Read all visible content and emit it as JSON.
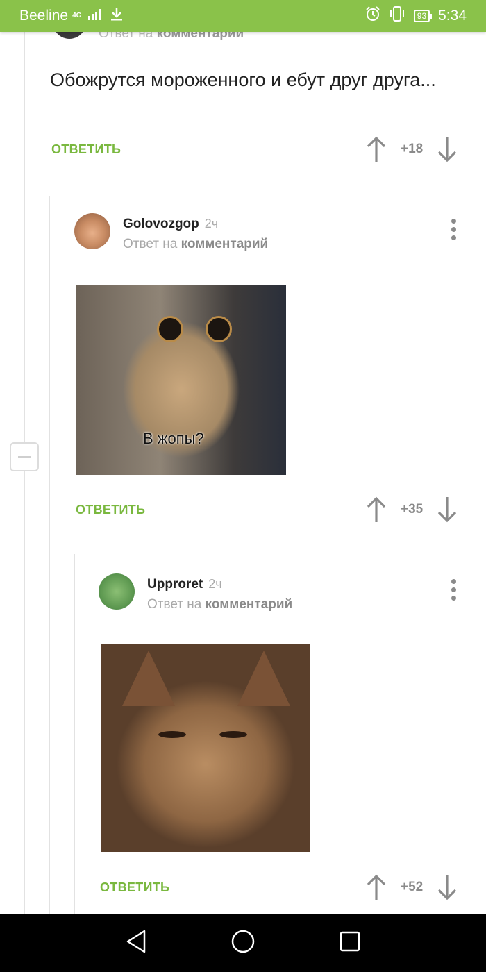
{
  "status_bar": {
    "carrier": "Beeline",
    "network": "4G",
    "battery": "93",
    "time": "5:34",
    "icons": [
      "signal-icon",
      "download-icon",
      "alarm-icon",
      "vibrate-icon",
      "battery-icon"
    ]
  },
  "partial_comment": {
    "reply_to_prefix": "Ответ на",
    "reply_to_link": "комментарий",
    "text": "Обожрутся мороженного и ебут друг друга...",
    "reply_label": "ОТВЕТИТЬ",
    "rating": "+18"
  },
  "comments": [
    {
      "author": "Golovozgop",
      "time": "2ч",
      "reply_to_prefix": "Ответ на",
      "reply_to_link": "комментарий",
      "image_caption": "В жопы?",
      "reply_label": "ОТВЕТИТЬ",
      "rating": "+35"
    },
    {
      "author": "Upproret",
      "time": "2ч",
      "reply_to_prefix": "Ответ на",
      "reply_to_link": "комментарий",
      "reply_label": "ОТВЕТИТЬ",
      "rating": "+52"
    }
  ],
  "colors": {
    "accent": "#8ac24a",
    "reply_green": "#7ab83f",
    "muted": "#8a8a8a"
  },
  "nav_bar": {
    "icons": [
      "back-icon",
      "home-icon",
      "recents-icon"
    ]
  }
}
